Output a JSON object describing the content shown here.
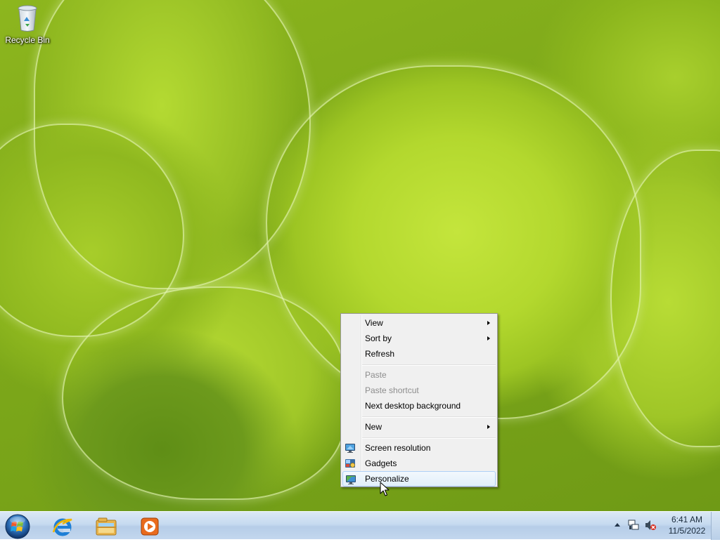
{
  "desktop": {
    "icons": [
      {
        "label": "Recycle Bin",
        "icon": "recycle-bin-icon"
      }
    ]
  },
  "context_menu": {
    "items": [
      {
        "label": "View",
        "submenu": true,
        "enabled": true
      },
      {
        "label": "Sort by",
        "submenu": true,
        "enabled": true
      },
      {
        "label": "Refresh",
        "submenu": false,
        "enabled": true
      },
      {
        "label": "Paste",
        "submenu": false,
        "enabled": false
      },
      {
        "label": "Paste shortcut",
        "submenu": false,
        "enabled": false
      },
      {
        "label": "Next desktop background",
        "submenu": false,
        "enabled": true
      },
      {
        "label": "New",
        "submenu": true,
        "enabled": true
      },
      {
        "label": "Screen resolution",
        "submenu": false,
        "enabled": true,
        "icon": "screen-resolution-icon"
      },
      {
        "label": "Gadgets",
        "submenu": false,
        "enabled": true,
        "icon": "gadgets-icon"
      },
      {
        "label": "Personalize",
        "submenu": false,
        "enabled": true,
        "icon": "personalize-icon",
        "highlighted": true
      }
    ]
  },
  "taskbar": {
    "start": {
      "icon": "windows-start-orb-icon"
    },
    "pinned": [
      {
        "icon": "internet-explorer-icon"
      },
      {
        "icon": "file-explorer-icon"
      },
      {
        "icon": "media-player-icon"
      }
    ],
    "tray": {
      "icons": [
        "show-hidden-icons-arrow",
        "network-icon",
        "volume-muted-icon"
      ],
      "time": "6:41 AM",
      "date": "11/5/2022"
    }
  },
  "colors": {
    "menu_background": "#f0f0f0",
    "menu_highlight_border": "#aecff7",
    "taskbar": "#c6daf0",
    "disabled_text": "#8d8d8d"
  }
}
